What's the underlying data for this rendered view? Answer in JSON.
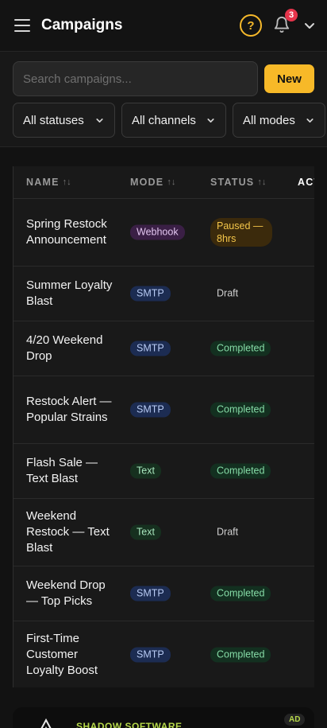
{
  "header": {
    "title": "Campaigns",
    "help_label": "?",
    "notification_count": "3"
  },
  "filters": {
    "search_placeholder": "Search campaigns...",
    "new_label": "New",
    "status_select": "All statuses",
    "channel_select": "All channels",
    "mode_select": "All modes"
  },
  "table": {
    "columns": {
      "name": "NAME",
      "mode": "MODE",
      "status": "STATUS",
      "actions": "ACT"
    },
    "sort_glyph": "↑↓",
    "rows": [
      {
        "name": "Spring Restock Announcement",
        "mode": "Webhook",
        "status": "Paused — 8hrs"
      },
      {
        "name": "Summer Loyalty Blast",
        "mode": "SMTP",
        "status": "Draft"
      },
      {
        "name": "4/20 Weekend Drop",
        "mode": "SMTP",
        "status": "Completed"
      },
      {
        "name": "Restock Alert — Popular Strains",
        "mode": "SMTP",
        "status": "Completed"
      },
      {
        "name": "Flash Sale — Text Blast",
        "mode": "Text",
        "status": "Completed"
      },
      {
        "name": "Weekend Restock — Text Blast",
        "mode": "Text",
        "status": "Draft"
      },
      {
        "name": "Weekend Drop — Top Picks",
        "mode": "SMTP",
        "status": "Completed"
      },
      {
        "name": "First-Time Customer Loyalty Boost",
        "mode": "SMTP",
        "status": "Completed"
      }
    ]
  },
  "ad": {
    "name": "SHADOW SOFTWARE",
    "badge": "AD"
  },
  "colors": {
    "accent": "#f7b928",
    "background": "#121212",
    "badge_red": "#e5344b",
    "ad_green": "#b6d84a"
  },
  "icons": {
    "menu": "hamburger-icon",
    "help": "help-circle-icon",
    "bell": "bell-icon",
    "chevron": "chevron-down-icon"
  }
}
